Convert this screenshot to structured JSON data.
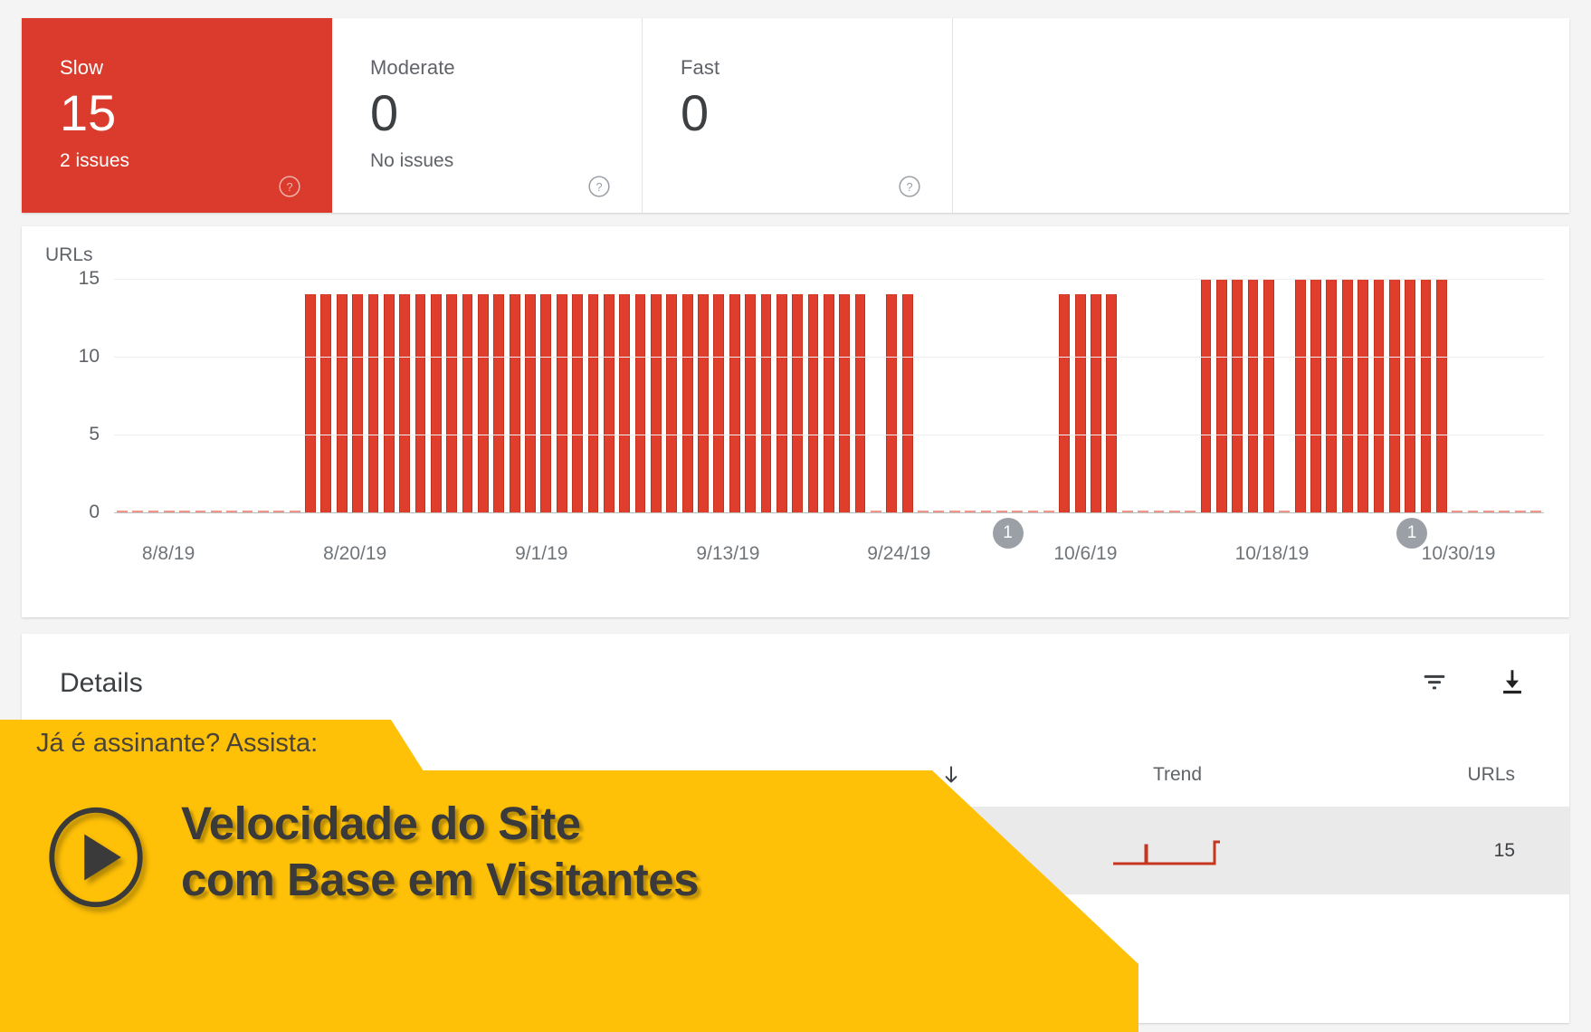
{
  "cards": [
    {
      "label": "Slow",
      "value": "15",
      "sub": "2 issues",
      "selected": true,
      "help": "help-icon"
    },
    {
      "label": "Moderate",
      "value": "0",
      "sub": "No issues",
      "selected": false,
      "help": "help-icon"
    },
    {
      "label": "Fast",
      "value": "0",
      "sub": "",
      "selected": false,
      "help": "help-icon"
    }
  ],
  "chart_panel": {
    "y_axis_title": "URLs"
  },
  "details": {
    "title": "Details",
    "filter_icon": "filter-icon",
    "download_icon": "download-icon",
    "columns": [
      "",
      "",
      "Trend",
      "URLs"
    ],
    "sort_icon": "arrow-down-icon",
    "rows": [
      {
        "type": "",
        "trend": "sparkline",
        "urls": "15"
      }
    ]
  },
  "promo": {
    "eyebrow": "Já é assinante? Assista:",
    "headline_line1": "Velocidade do Site",
    "headline_line2": "com Base em Visitantes",
    "play_icon": "play-icon",
    "accent_color": "#ffc107"
  },
  "chart_data": {
    "type": "bar",
    "title": "",
    "xlabel": "",
    "ylabel": "URLs",
    "ylim": [
      0,
      15
    ],
    "yticks": [
      0,
      5,
      10,
      15
    ],
    "grid": true,
    "legend": false,
    "series_color": "#e03e2d",
    "x_tick_labels": [
      "8/8/19",
      "8/20/19",
      "9/1/19",
      "9/13/19",
      "9/24/19",
      "10/6/19",
      "10/18/19",
      "10/30/19"
    ],
    "x_tick_positions": [
      3,
      15,
      27,
      39,
      50,
      62,
      74,
      86
    ],
    "annotations": [
      {
        "label": "1",
        "x_index": 57
      },
      {
        "label": "1",
        "x_index": 83
      }
    ],
    "n_points": 92,
    "values": [
      0,
      0,
      0,
      0,
      0,
      0,
      0,
      0,
      0,
      0,
      0,
      0,
      14,
      14,
      14,
      14,
      14,
      14,
      14,
      14,
      14,
      14,
      14,
      14,
      14,
      14,
      14,
      14,
      14,
      14,
      14,
      14,
      14,
      14,
      14,
      14,
      14,
      14,
      14,
      14,
      14,
      14,
      14,
      14,
      14,
      14,
      14,
      14,
      0,
      14,
      14,
      0,
      0,
      0,
      0,
      0,
      0,
      0,
      0,
      0,
      14,
      14,
      14,
      14,
      0,
      0,
      0,
      0,
      0,
      15,
      15,
      15,
      15,
      15,
      0,
      15,
      15,
      15,
      15,
      15,
      15,
      15,
      15,
      15,
      15,
      0,
      0,
      0,
      0,
      0,
      0
    ]
  }
}
